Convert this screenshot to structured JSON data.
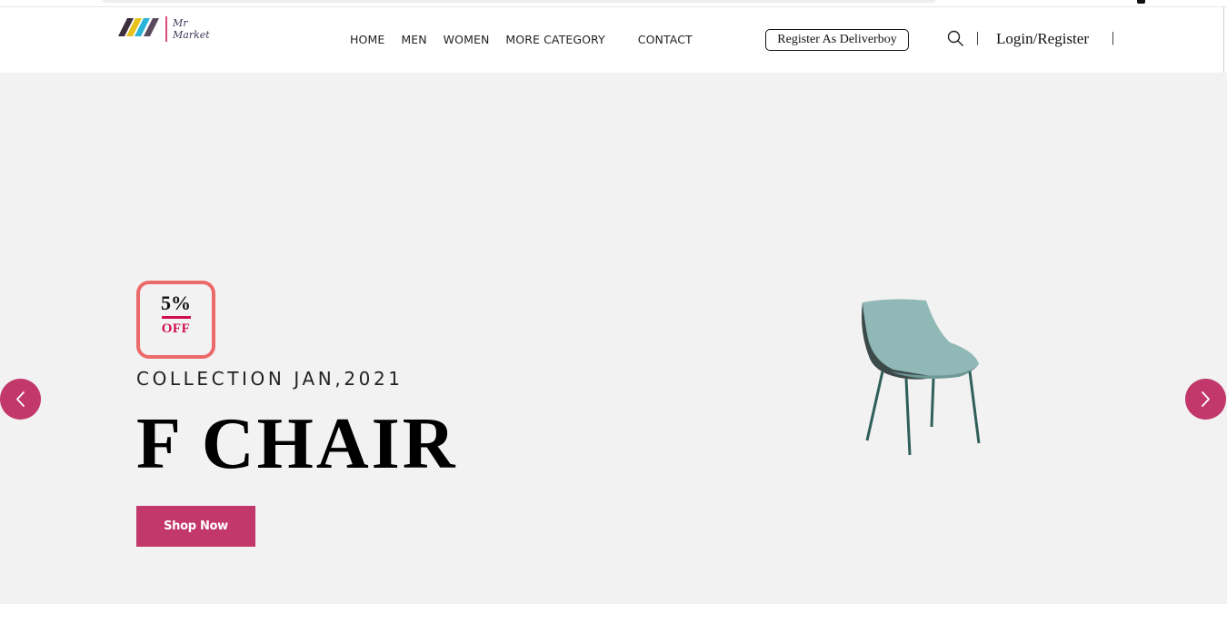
{
  "brand": {
    "logo_text_line1": "Mr",
    "logo_text_line2": "Market"
  },
  "nav": {
    "items": [
      "HOME",
      "MEN",
      "WOMEN",
      "MORE CATEGORY",
      "CONTACT"
    ]
  },
  "header": {
    "register_deliveryboy": "Register As Deliverboy",
    "separator": "|",
    "login_register": "Login/Register"
  },
  "hero": {
    "badge_percent": "5%",
    "badge_off": "OFF",
    "collection": "COLLECTION JAN,2021",
    "title": "F CHAIR",
    "cta": "Shop Now"
  },
  "icons": {
    "search": "search-icon",
    "prev": "chevron-left-icon",
    "next": "chevron-right-icon"
  },
  "colors": {
    "accent": "#c2386a",
    "badge_border": "#ec6a6a",
    "badge_red": "#d0104c",
    "hero_bg": "#f2f2f2"
  }
}
